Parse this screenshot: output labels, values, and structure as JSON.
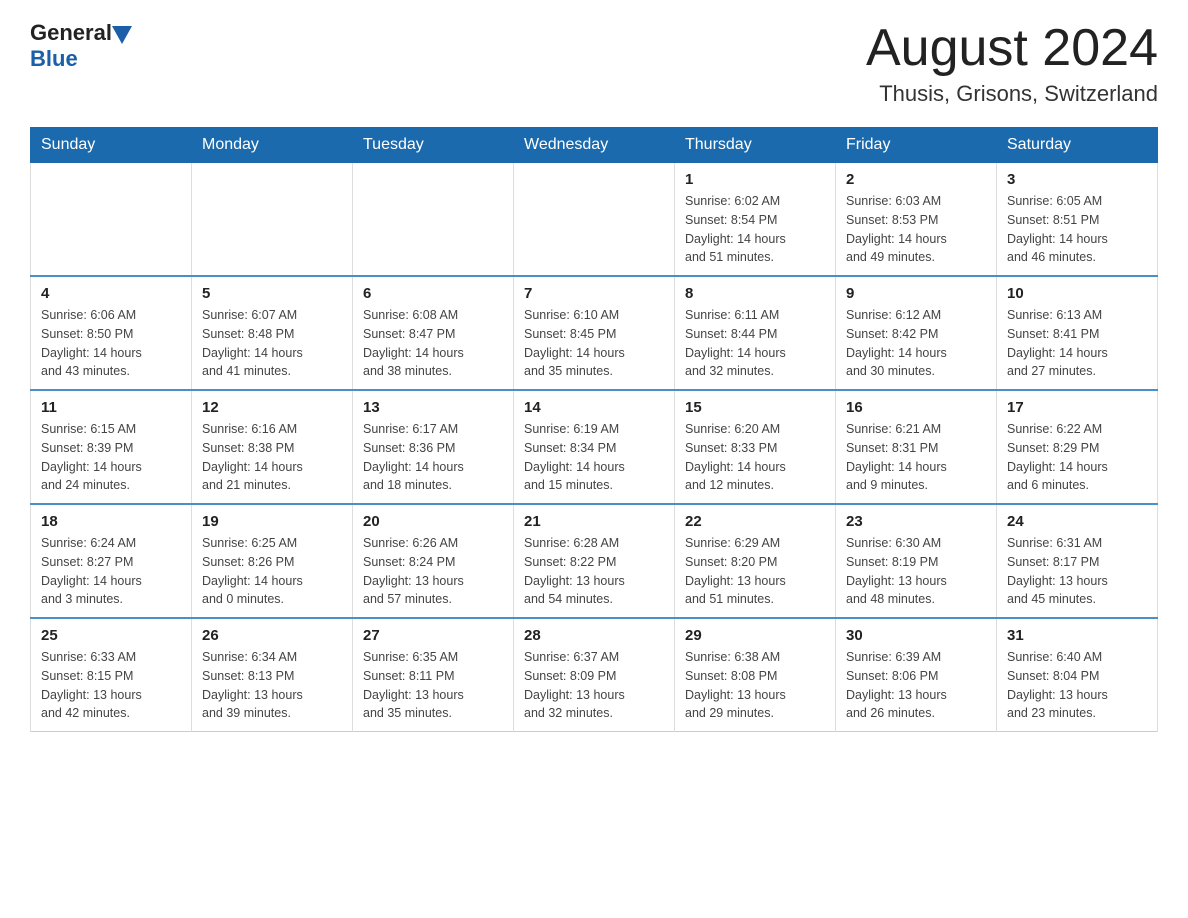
{
  "header": {
    "logo_general": "General",
    "logo_blue": "Blue",
    "month_title": "August 2024",
    "location": "Thusis, Grisons, Switzerland"
  },
  "days_of_week": [
    "Sunday",
    "Monday",
    "Tuesday",
    "Wednesday",
    "Thursday",
    "Friday",
    "Saturday"
  ],
  "weeks": [
    [
      {
        "day": "",
        "info": ""
      },
      {
        "day": "",
        "info": ""
      },
      {
        "day": "",
        "info": ""
      },
      {
        "day": "",
        "info": ""
      },
      {
        "day": "1",
        "info": "Sunrise: 6:02 AM\nSunset: 8:54 PM\nDaylight: 14 hours\nand 51 minutes."
      },
      {
        "day": "2",
        "info": "Sunrise: 6:03 AM\nSunset: 8:53 PM\nDaylight: 14 hours\nand 49 minutes."
      },
      {
        "day": "3",
        "info": "Sunrise: 6:05 AM\nSunset: 8:51 PM\nDaylight: 14 hours\nand 46 minutes."
      }
    ],
    [
      {
        "day": "4",
        "info": "Sunrise: 6:06 AM\nSunset: 8:50 PM\nDaylight: 14 hours\nand 43 minutes."
      },
      {
        "day": "5",
        "info": "Sunrise: 6:07 AM\nSunset: 8:48 PM\nDaylight: 14 hours\nand 41 minutes."
      },
      {
        "day": "6",
        "info": "Sunrise: 6:08 AM\nSunset: 8:47 PM\nDaylight: 14 hours\nand 38 minutes."
      },
      {
        "day": "7",
        "info": "Sunrise: 6:10 AM\nSunset: 8:45 PM\nDaylight: 14 hours\nand 35 minutes."
      },
      {
        "day": "8",
        "info": "Sunrise: 6:11 AM\nSunset: 8:44 PM\nDaylight: 14 hours\nand 32 minutes."
      },
      {
        "day": "9",
        "info": "Sunrise: 6:12 AM\nSunset: 8:42 PM\nDaylight: 14 hours\nand 30 minutes."
      },
      {
        "day": "10",
        "info": "Sunrise: 6:13 AM\nSunset: 8:41 PM\nDaylight: 14 hours\nand 27 minutes."
      }
    ],
    [
      {
        "day": "11",
        "info": "Sunrise: 6:15 AM\nSunset: 8:39 PM\nDaylight: 14 hours\nand 24 minutes."
      },
      {
        "day": "12",
        "info": "Sunrise: 6:16 AM\nSunset: 8:38 PM\nDaylight: 14 hours\nand 21 minutes."
      },
      {
        "day": "13",
        "info": "Sunrise: 6:17 AM\nSunset: 8:36 PM\nDaylight: 14 hours\nand 18 minutes."
      },
      {
        "day": "14",
        "info": "Sunrise: 6:19 AM\nSunset: 8:34 PM\nDaylight: 14 hours\nand 15 minutes."
      },
      {
        "day": "15",
        "info": "Sunrise: 6:20 AM\nSunset: 8:33 PM\nDaylight: 14 hours\nand 12 minutes."
      },
      {
        "day": "16",
        "info": "Sunrise: 6:21 AM\nSunset: 8:31 PM\nDaylight: 14 hours\nand 9 minutes."
      },
      {
        "day": "17",
        "info": "Sunrise: 6:22 AM\nSunset: 8:29 PM\nDaylight: 14 hours\nand 6 minutes."
      }
    ],
    [
      {
        "day": "18",
        "info": "Sunrise: 6:24 AM\nSunset: 8:27 PM\nDaylight: 14 hours\nand 3 minutes."
      },
      {
        "day": "19",
        "info": "Sunrise: 6:25 AM\nSunset: 8:26 PM\nDaylight: 14 hours\nand 0 minutes."
      },
      {
        "day": "20",
        "info": "Sunrise: 6:26 AM\nSunset: 8:24 PM\nDaylight: 13 hours\nand 57 minutes."
      },
      {
        "day": "21",
        "info": "Sunrise: 6:28 AM\nSunset: 8:22 PM\nDaylight: 13 hours\nand 54 minutes."
      },
      {
        "day": "22",
        "info": "Sunrise: 6:29 AM\nSunset: 8:20 PM\nDaylight: 13 hours\nand 51 minutes."
      },
      {
        "day": "23",
        "info": "Sunrise: 6:30 AM\nSunset: 8:19 PM\nDaylight: 13 hours\nand 48 minutes."
      },
      {
        "day": "24",
        "info": "Sunrise: 6:31 AM\nSunset: 8:17 PM\nDaylight: 13 hours\nand 45 minutes."
      }
    ],
    [
      {
        "day": "25",
        "info": "Sunrise: 6:33 AM\nSunset: 8:15 PM\nDaylight: 13 hours\nand 42 minutes."
      },
      {
        "day": "26",
        "info": "Sunrise: 6:34 AM\nSunset: 8:13 PM\nDaylight: 13 hours\nand 39 minutes."
      },
      {
        "day": "27",
        "info": "Sunrise: 6:35 AM\nSunset: 8:11 PM\nDaylight: 13 hours\nand 35 minutes."
      },
      {
        "day": "28",
        "info": "Sunrise: 6:37 AM\nSunset: 8:09 PM\nDaylight: 13 hours\nand 32 minutes."
      },
      {
        "day": "29",
        "info": "Sunrise: 6:38 AM\nSunset: 8:08 PM\nDaylight: 13 hours\nand 29 minutes."
      },
      {
        "day": "30",
        "info": "Sunrise: 6:39 AM\nSunset: 8:06 PM\nDaylight: 13 hours\nand 26 minutes."
      },
      {
        "day": "31",
        "info": "Sunrise: 6:40 AM\nSunset: 8:04 PM\nDaylight: 13 hours\nand 23 minutes."
      }
    ]
  ]
}
